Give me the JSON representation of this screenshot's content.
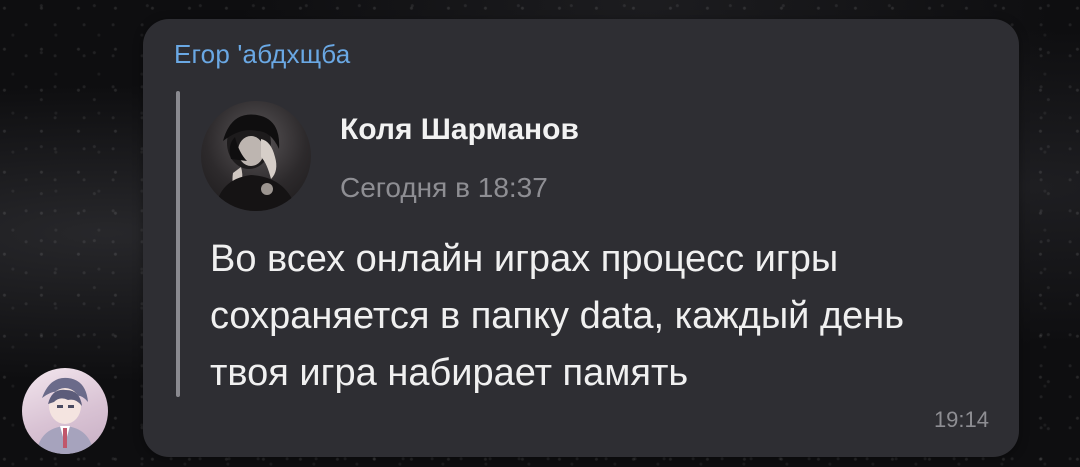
{
  "message": {
    "sender_name": "Егор 'абдхщба",
    "forwarded": {
      "author": "Коля Шарманов",
      "date": "Сегодня в 18:37"
    },
    "text": "Во всех онлайн играх процесс игры сохраняется в папку data, каждый день твоя игра набирает память",
    "time": "19:14"
  },
  "colors": {
    "bubble": "#2e2e33",
    "sender_name": "#6aa8e4",
    "muted_text": "#8e8e93",
    "primary_text": "#f0f0f0"
  },
  "icons": {
    "forward_avatar": "user-photo-avatar",
    "sender_avatar": "user-anime-avatar"
  }
}
